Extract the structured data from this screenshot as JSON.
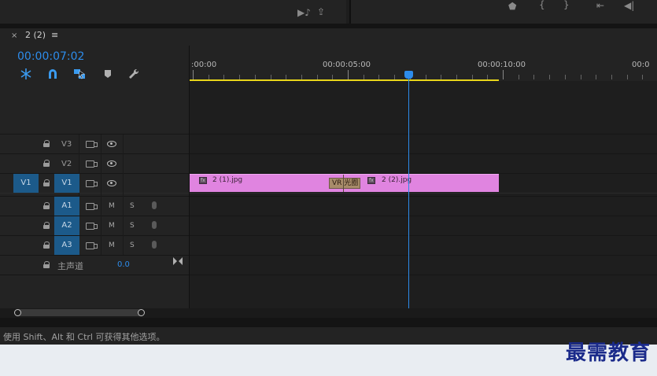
{
  "sequence": {
    "tab_close": "×",
    "tab_title": "2 (2)",
    "tab_menu": "≡",
    "timecode": "00:00:07:02"
  },
  "ruler": {
    "labels": [
      ":00:00",
      "00:00:05:00",
      "00:00:10:00",
      "00:0"
    ]
  },
  "video_tracks": [
    {
      "name": "V3"
    },
    {
      "name": "V2"
    },
    {
      "name": "V1",
      "source_patch": "V1"
    }
  ],
  "audio_tracks": [
    {
      "name": "A1",
      "mute": "M",
      "solo": "S"
    },
    {
      "name": "A2",
      "mute": "M",
      "solo": "S"
    },
    {
      "name": "A3",
      "mute": "M",
      "solo": "S"
    }
  ],
  "master": {
    "label": "主声道",
    "value": "0.0"
  },
  "clips": [
    {
      "name": "2 (1).jpg",
      "fx": "fx"
    },
    {
      "name": "2 (2).jpg",
      "fx": "fx"
    }
  ],
  "transition": {
    "label": "VR 光圈"
  },
  "status": {
    "text": "使用 Shift、Alt 和 Ctrl 可获得其他选项。"
  },
  "watermark": {
    "text": "最需教育"
  },
  "colors": {
    "accent": "#2d8ceb",
    "clip": "#e084e0",
    "work_area": "#e8d51a",
    "selected_track": "#1c5a8a"
  }
}
